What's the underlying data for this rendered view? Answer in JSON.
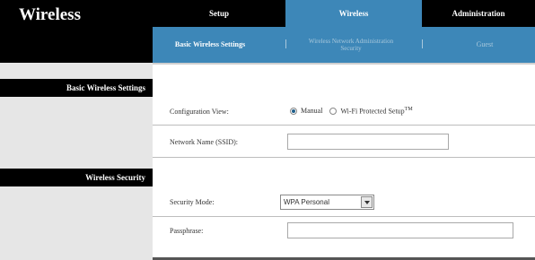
{
  "app": {
    "title": "Wireless"
  },
  "tabs": [
    {
      "label": "Setup"
    },
    {
      "label": "Wireless"
    },
    {
      "label": "Administration"
    }
  ],
  "subtabs": [
    {
      "label": "Basic Wireless Settings"
    },
    {
      "label": "Wireless Network Administration Security"
    },
    {
      "label": "Guest"
    }
  ],
  "sections": {
    "basic": "Basic Wireless Settings",
    "security": "Wireless Security"
  },
  "form": {
    "config_view": {
      "label": "Configuration View:",
      "options": [
        "Manual",
        "Wi-Fi Protected Setup"
      ],
      "tm": "TM",
      "selected": "Manual"
    },
    "network_name": {
      "label": "Network Name (SSID):",
      "value": ""
    },
    "security_mode": {
      "label": "Security Mode:",
      "value": "WPA Personal"
    },
    "passphrase": {
      "label": "Passphrase:",
      "value": ""
    }
  },
  "colors": {
    "accent": "#3d87b8",
    "black": "#000000",
    "sidebar": "#e6e6e6"
  }
}
